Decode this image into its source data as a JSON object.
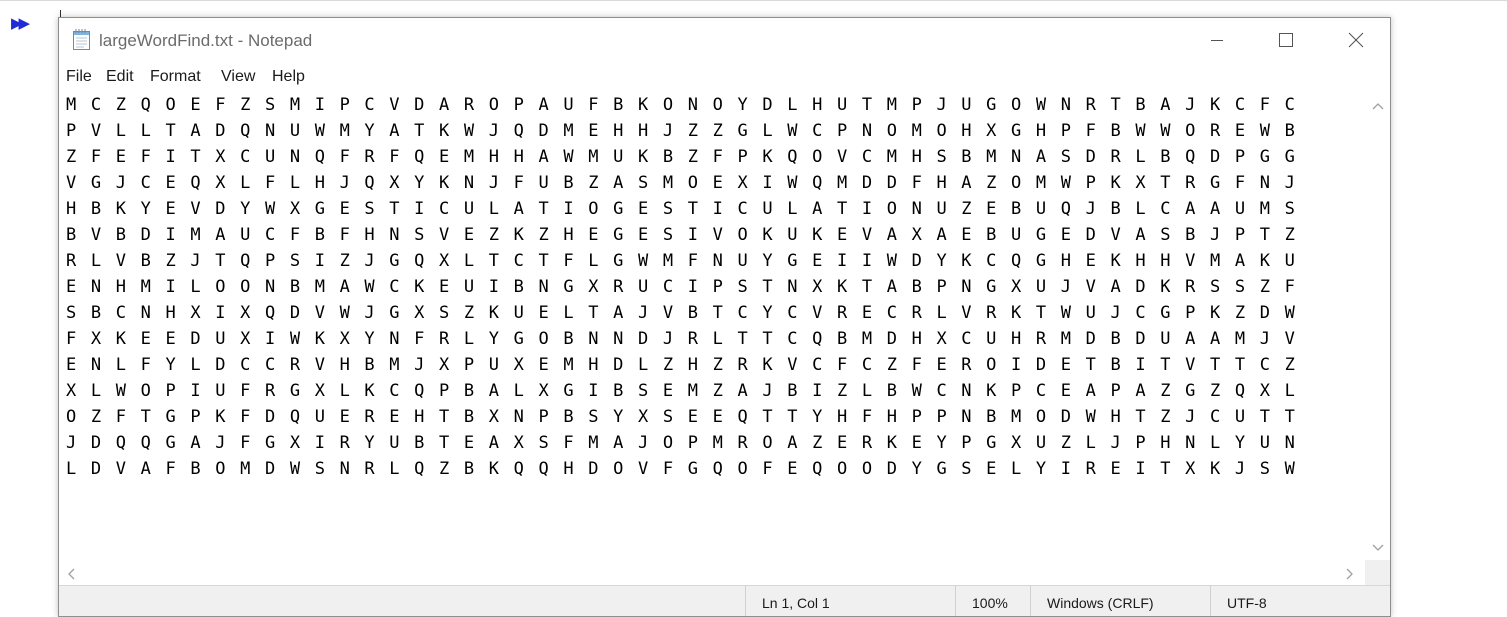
{
  "window": {
    "title": "largeWordFind.txt - Notepad",
    "accent": "#1f2bd6"
  },
  "background": {
    "run_indicator": "▶▶"
  },
  "icons": {
    "app": "notepad-icon",
    "minimize": "minimize-icon",
    "maximize": "maximize-icon",
    "close": "close-icon",
    "scroll_up": "chevron-up-icon",
    "scroll_down": "chevron-down-icon",
    "scroll_left": "chevron-left-icon",
    "scroll_right": "chevron-right-icon"
  },
  "menu": {
    "file": "File",
    "edit": "Edit",
    "format": "Format",
    "view": "View",
    "help": "Help"
  },
  "editor": {
    "lines": [
      "M C Z Q O E F Z S M I P C V D A R O P A U F B K O N O Y D L H U T M P J U G O W N R T B A J K C F C",
      "P V L L T A D Q N U W M Y A T K W J Q D M E H H J Z Z G L W C P N O M O H X G H P F B W W O R E W B",
      "Z F E F I T X C U N Q F R F Q E M H H A W M U K B Z F P K Q O V C M H S B M N A S D R L B Q D P G G",
      "V G J C E Q X L F L H J Q X Y K N J F U B Z A S M O E X I W Q M D D F H A Z O M W P K X T R G F N J",
      "H B K Y E V D Y W X G E S T I C U L A T I O G E S T I C U L A T I O N U Z E B U Q J B L C A A U M S",
      "B V B D I M A U C F B F H N S V E Z K Z H E G E S I V O K U K E V A X A E B U G E D V A S B J P T Z",
      "R L V B Z J T Q P S I Z J G Q X L T C T F L G W M F N U Y G E I I W D Y K C Q G H E K H H V M A K U",
      "E N H M I L O O N B M A W C K E U I B N G X R U C I P S T N X K T A B P N G X U J V A D K R S S Z F",
      "S B C N H X I X Q D V W J G X S Z K U E L T A J V B T C Y C V R E C R L V R K T W U J C G P K Z D W",
      "F X K E E D U X I W K X Y N F R L Y G O B N N D J R L T T C Q B M D H X C U H R M D B D U A A M J V",
      "E N L F Y L D C C R V H B M J X P U X E M H D L Z H Z R K V C F C Z F E R O I D E T B I T V T T C Z",
      "X L W O P I U F R G X L K C Q P B A L X G I B S E M Z A J B I Z L B W C N K P C E A P A Z G Z Q X L",
      "O Z F T G P K F D Q U E R E H T B X N P B S Y X S E E Q T T Y H F H P P N B M O D W H T Z J C U T T",
      "J D Q Q G A J F G X I R Y U B T E A X S F M A J O P M R O A Z E R K E Y P G X U Z L J P H N L Y U N",
      "L D V A F B O M D W S N R L Q Z B K Q Q H D O V F G Q O F E Q O O D Y G S E L Y I R E I T X K J S W"
    ]
  },
  "statusbar": {
    "position": "Ln 1, Col 1",
    "zoom": "100%",
    "line_ending": "Windows (CRLF)",
    "encoding": "UTF-8"
  }
}
